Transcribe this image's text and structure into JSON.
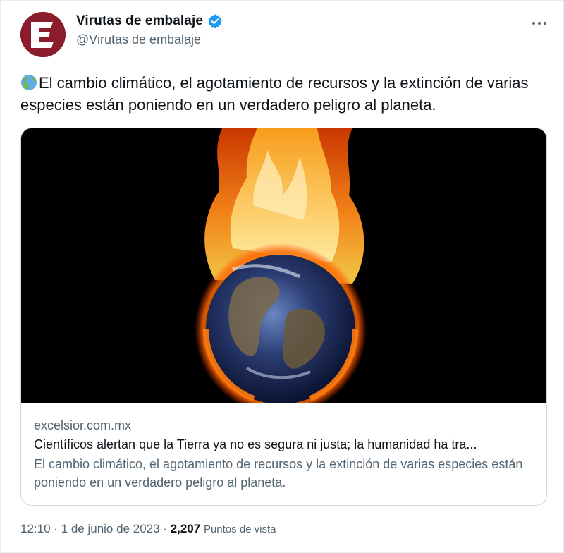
{
  "author": {
    "name": "Virutas de embalaje",
    "handle": "@Virutas de embalaje",
    "avatar_letter": "E",
    "avatar_color": "#8b1c2c",
    "verified_color": "#1d9bf0"
  },
  "tweet": {
    "emoji": "earth-globe-americas-icon",
    "text": "El cambio climático, el agotamiento de recursos y la extinción de varias especies están poniendo en un verdadero peligro al planeta."
  },
  "card": {
    "image_icon": "burning-earth-image",
    "domain": "excelsior.com.mx",
    "title": "Científicos alertan que la Tierra ya no es segura ni justa; la humanidad ha tra...",
    "description": "El cambio climático, el agotamiento de recursos y la extinción de varias especies están poniendo en un verdadero peligro al planeta."
  },
  "meta": {
    "time": "12:10",
    "separator1": " · ",
    "date": "1 de junio de 2023",
    "separator2": " · ",
    "views_count": "2,207",
    "views_label": "Puntos de vista"
  }
}
